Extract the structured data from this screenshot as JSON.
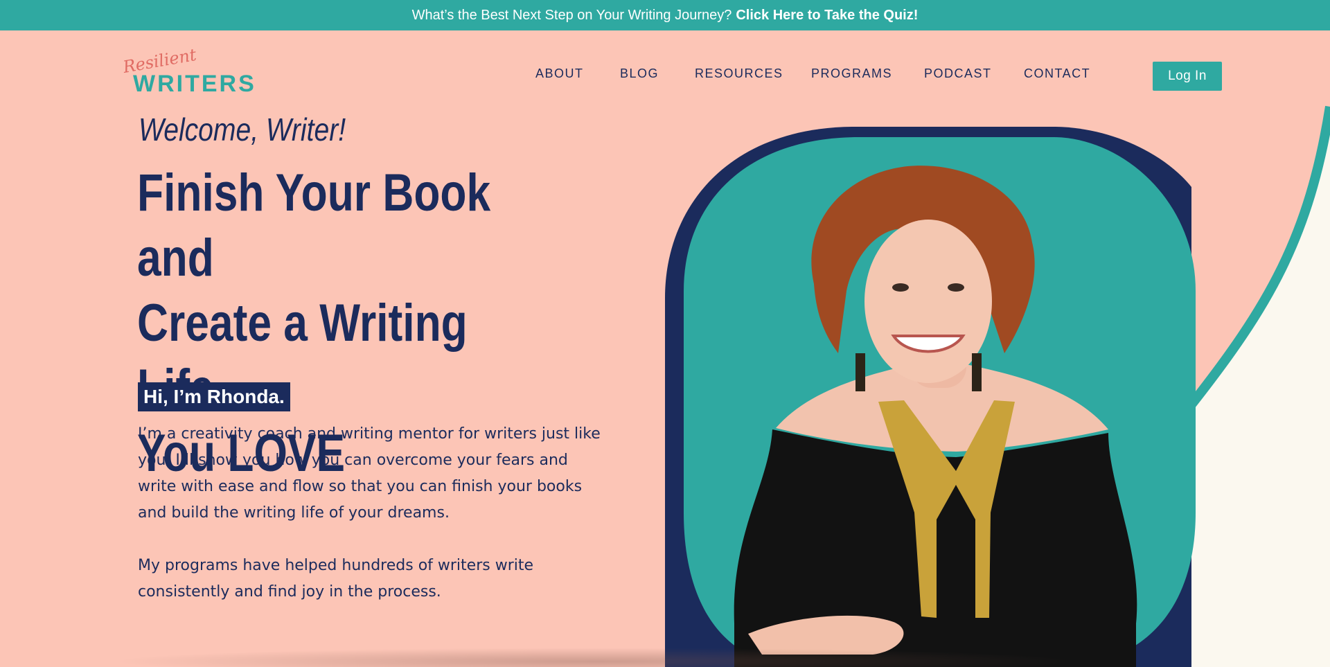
{
  "topbar": {
    "text": "What’s the Best Next Step on Your Writing Journey?",
    "link": "Click Here to Take the Quiz!"
  },
  "logo": {
    "script": "Resilient",
    "main": "WRITERS"
  },
  "nav": {
    "items": [
      {
        "label": "ABOUT"
      },
      {
        "label": "BLOG"
      },
      {
        "label": "RESOURCES"
      },
      {
        "label": "PROGRAMS"
      },
      {
        "label": "PODCAST"
      },
      {
        "label": "CONTACT"
      }
    ],
    "login": "Log In"
  },
  "hero": {
    "welcome": "Welcome, Writer!",
    "headline_line1": "Finish Your Book and",
    "headline_line2": "Create a Writing Life",
    "headline_line3": "You LOVE",
    "badge": "Hi, I’m Rhonda.",
    "paragraph1": "I’m a creativity coach and writing mentor for writers just like you. I’ll show you how you can overcome your fears and write with ease and flow so that you can finish your books and build the writing life of your dreams.",
    "paragraph2": "My programs have helped hundreds of writers write consistently and find joy in the process."
  },
  "colors": {
    "teal": "#2fa9a1",
    "navy": "#1b2b5c",
    "peach": "#fcc5b6",
    "cream": "#fbf8ef",
    "coral": "#e06b63"
  }
}
